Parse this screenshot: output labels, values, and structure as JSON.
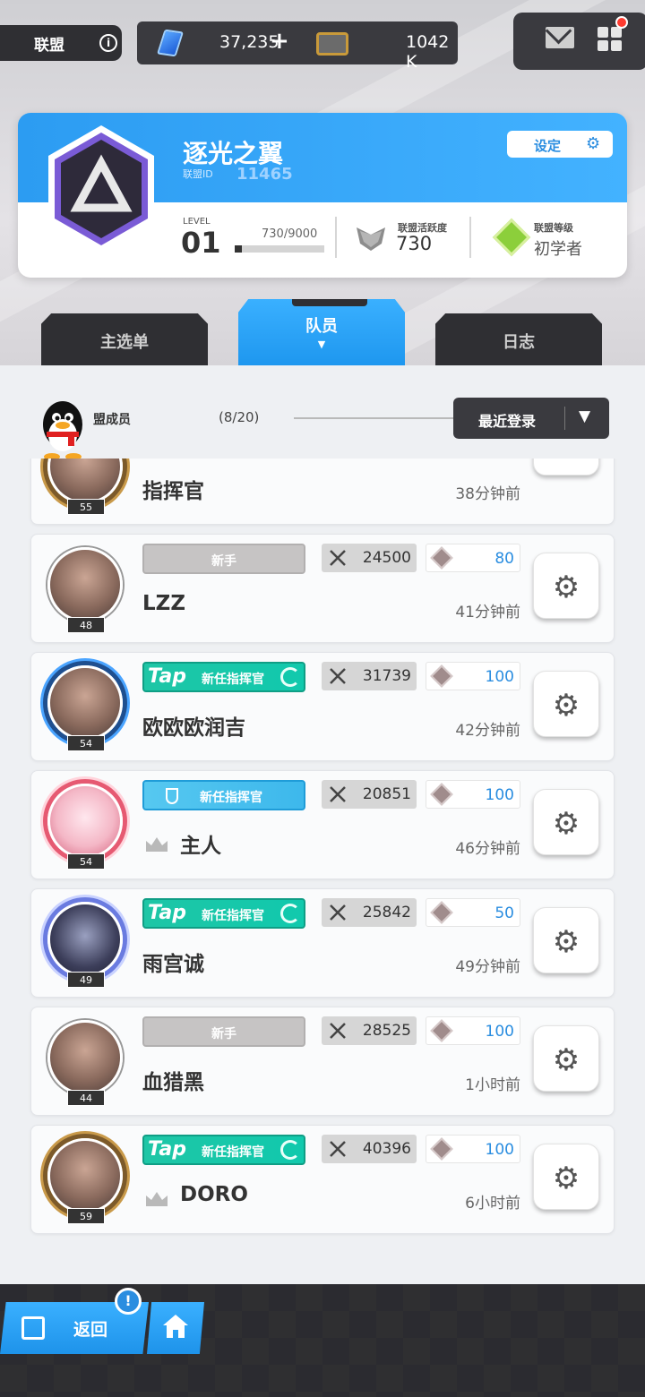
{
  "topbar": {
    "alliance_label": "联盟",
    "gems": "37,235",
    "tickets": "1042 K"
  },
  "alliance": {
    "name": "逐光之翼",
    "id_label": "联盟ID",
    "id": "11465",
    "settings_label": "设定",
    "level_label": "LEVEL",
    "level": "01",
    "exp_text": "730/9000",
    "exp_fraction": 0.081,
    "activity_label": "联盟活跃度",
    "activity": "730",
    "rank_label": "联盟等级",
    "rank": "初学者"
  },
  "tabs": [
    {
      "label": "主选单"
    },
    {
      "label": "队员"
    },
    {
      "label": "日志"
    }
  ],
  "members_header": {
    "label": "盟成员",
    "count": "(8/20)",
    "sort_label": "最近登录"
  },
  "members": [
    {
      "name": "指挥官",
      "level": "55",
      "last_login": "38分钟前"
    },
    {
      "name": "LZZ",
      "level": "48",
      "tag": "新手",
      "power": "24500",
      "contrib": "80",
      "last_login": "41分钟前"
    },
    {
      "name": "欧欧欧润吉",
      "level": "54",
      "tag": "新任指挥官",
      "tag_logo": "Tap",
      "power": "31739",
      "contrib": "100",
      "last_login": "42分钟前"
    },
    {
      "name": "主人",
      "level": "54",
      "tag": "新任指挥官",
      "power": "20851",
      "contrib": "100",
      "last_login": "46分钟前"
    },
    {
      "name": "雨宫诚",
      "level": "49",
      "tag": "新任指挥官",
      "tag_logo": "Tap",
      "power": "25842",
      "contrib": "50",
      "last_login": "49分钟前"
    },
    {
      "name": "血猎黑",
      "level": "44",
      "tag": "新手",
      "power": "28525",
      "contrib": "100",
      "last_login": "1小时前"
    },
    {
      "name": "DORO",
      "level": "59",
      "tag": "新任指挥官",
      "tag_logo": "Tap",
      "power": "40396",
      "contrib": "100",
      "last_login": "6小时前"
    }
  ],
  "bottom": {
    "back_label": "返回",
    "notif": "!"
  },
  "colors": {
    "accent": "#2c9cf2",
    "tap_tag": "#1ec6a6",
    "dark": "#2f2f33"
  }
}
